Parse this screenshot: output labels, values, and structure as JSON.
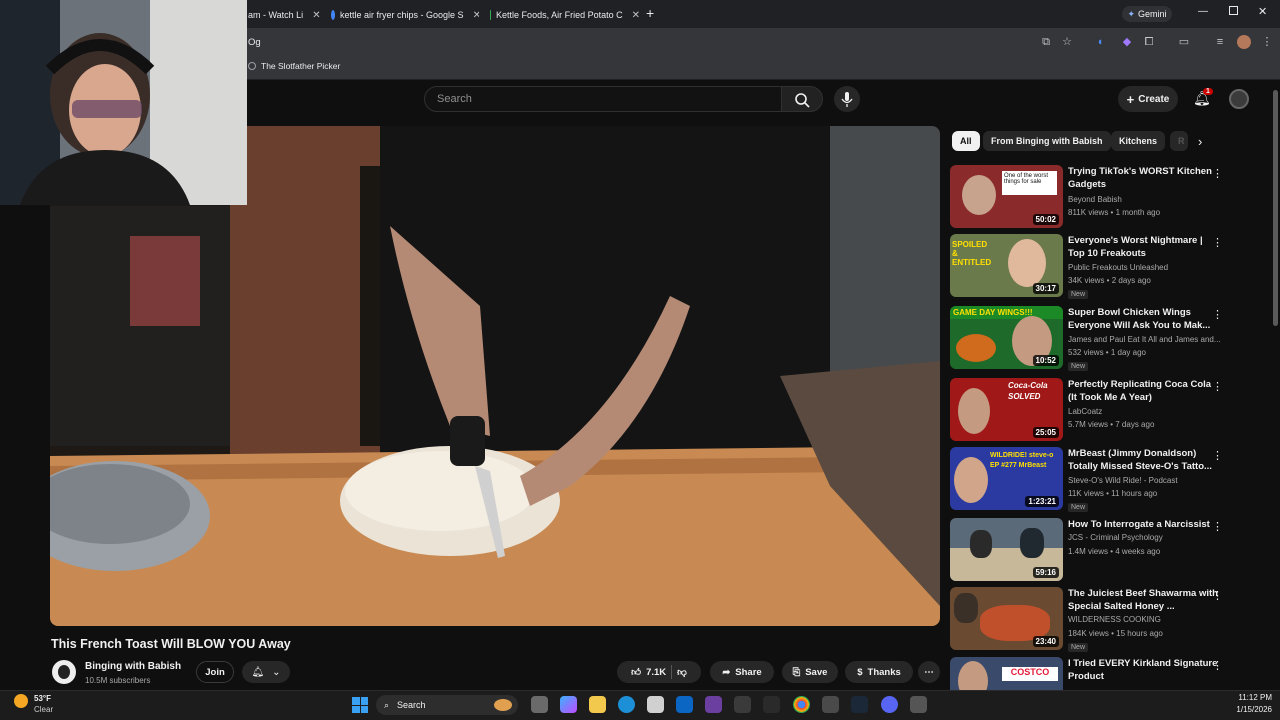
{
  "browser": {
    "tabs": [
      {
        "label": "am - Watch Li",
        "color": "#9146ff"
      },
      {
        "label": "kettle air fryer chips - Google S",
        "color": "#ffffff"
      },
      {
        "label": "Kettle Foods, Air Fried Potato C",
        "color": "#34a853"
      }
    ],
    "gemini_label": "Gemini",
    "address": "Og",
    "bookmark": "The Slotfather Picker"
  },
  "youtube": {
    "search_placeholder": "Search",
    "create_label": "Create",
    "notification_count": "1",
    "video_title": "This French Toast Will BLOW YOU Away",
    "channel_name": "Binging with Babish",
    "subscribers": "10.5M subscribers",
    "join_label": "Join",
    "likes": "7.1K",
    "share_label": "Share",
    "save_label": "Save",
    "thanks_label": "Thanks",
    "chips": [
      "All",
      "From Binging with Babish",
      "Kitchens",
      "R"
    ],
    "recommendations": [
      {
        "title": "Trying TikTok's WORST Kitchen Gadgets",
        "channel": "Beyond Babish",
        "meta": "811K views • 1 month ago",
        "duration": "50:02",
        "new": "",
        "thumb": "#8a2a2a",
        "thumb_text": "One of the worst things for sale"
      },
      {
        "title": "Everyone's Worst Nightmare | Top 10 Freakouts",
        "channel": "Public Freakouts Unleashed",
        "meta": "34K views • 2 days ago",
        "duration": "30:17",
        "new": "New",
        "thumb": "#6a7a4a",
        "thumb_text": "SPOILED & ENTITLED"
      },
      {
        "title": "Super Bowl Chicken Wings Everyone Will Ask You to Mak...",
        "channel": "James and Paul Eat It All and James and...",
        "meta": "532 views • 1 day ago",
        "duration": "10:52",
        "new": "New",
        "thumb": "#1e6a2a",
        "thumb_text": "GAME DAY WINGS!!!"
      },
      {
        "title": "Perfectly Replicating Coca Cola (It Took Me A Year)",
        "channel": "LabCoatz",
        "meta": "5.7M views • 7 days ago",
        "duration": "25:05",
        "new": "",
        "thumb": "#a01818",
        "thumb_text": "Coca-Cola SOLVED"
      },
      {
        "title": "MrBeast (Jimmy Donaldson) Totally Missed Steve-O's Tatto...",
        "channel": "Steve-O's Wild Ride! - Podcast",
        "meta": "11K views • 11 hours ago",
        "duration": "1:23:21",
        "new": "New",
        "thumb": "#2a3aa0",
        "thumb_text": "WILDRIDE! steve-o EP #277 MrBeast"
      },
      {
        "title": "How To Interrogate a Narcissist",
        "channel": "JCS - Criminal Psychology",
        "meta": "1.4M views • 4 weeks ago",
        "duration": "59:16",
        "new": "",
        "thumb": "#5a6a78",
        "thumb_text": ""
      },
      {
        "title": "The Juiciest Beef Shawarma with Special Salted Honey ...",
        "channel": "WILDERNESS COOKING",
        "meta": "184K views • 15 hours ago",
        "duration": "23:40",
        "new": "New",
        "thumb": "#6a4a30",
        "thumb_text": ""
      },
      {
        "title": "I Tried EVERY Kirkland Signature Product",
        "channel": "",
        "meta": "",
        "duration": "",
        "new": "",
        "thumb": "#3a4a6a",
        "thumb_text": "COSTCO"
      }
    ]
  },
  "taskbar": {
    "weather_temp": "53°F",
    "weather_desc": "Clear",
    "search_label": "Search",
    "time": "11:12 PM",
    "date": "1/15/2026"
  },
  "colors": {
    "accent_red": "#ff0000",
    "chip_active": "#f1f1f1",
    "bg": "#0f0f0f"
  }
}
